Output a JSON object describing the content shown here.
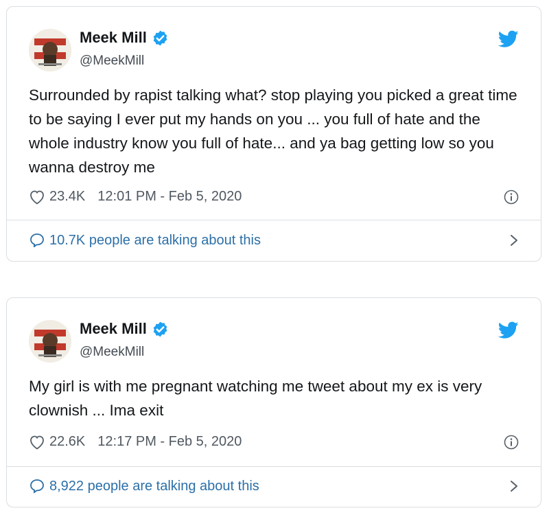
{
  "tweets": [
    {
      "name": "Meek Mill",
      "handle": "@MeekMill",
      "text": "Surrounded by rapist talking what? stop playing you picked a great time to be saying I ever put my hands on you ... you full of hate and the whole industry know you full of hate... and ya bag getting low so you wanna destroy me",
      "likes": "23.4K",
      "timestamp": "12:01 PM - Feb 5, 2020",
      "talking": "10.7K people are talking about this"
    },
    {
      "name": "Meek Mill",
      "handle": "@MeekMill",
      "text": "My girl is with me pregnant watching me tweet about my ex is very clownish ... Ima exit",
      "likes": "22.6K",
      "timestamp": "12:17 PM - Feb 5, 2020",
      "talking": "8,922 people are talking about this"
    }
  ],
  "colors": {
    "verified": "#1da1f2",
    "twitter_bird": "#1da1f2",
    "link": "#2b6fa8",
    "avatar_red": "#c0392b"
  },
  "icons": [
    "verified-badge-icon",
    "twitter-bird-icon",
    "heart-icon",
    "info-icon",
    "reply-bubble-icon",
    "chevron-right-icon"
  ]
}
